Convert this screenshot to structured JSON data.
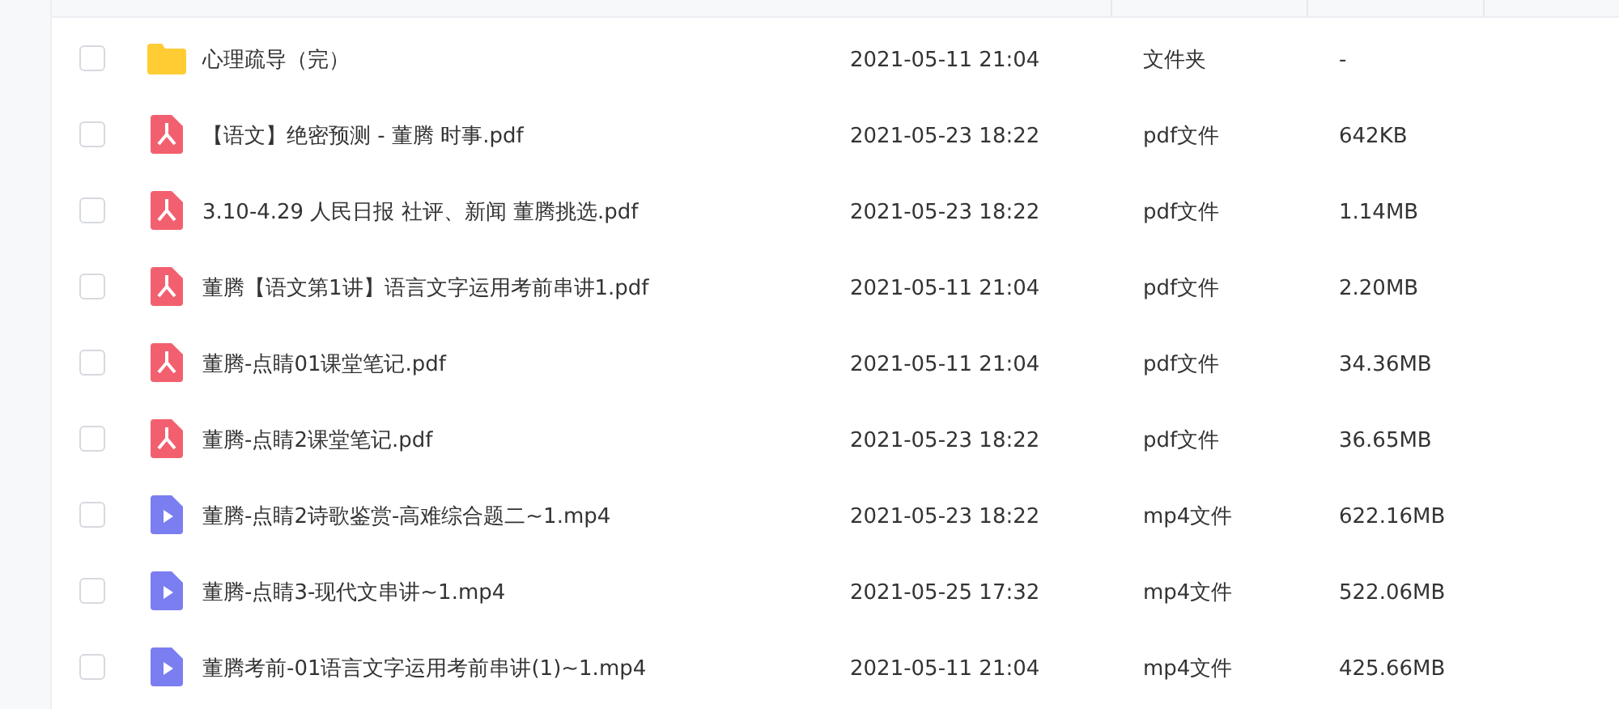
{
  "files": [
    {
      "kind": "folder",
      "checked": false,
      "name": "心理疏导（完）",
      "modified": "2021-05-11 21:04",
      "type": "文件夹",
      "size": "-"
    },
    {
      "kind": "pdf",
      "checked": false,
      "name": "【语文】绝密预测 - 董腾 时事.pdf",
      "modified": "2021-05-23 18:22",
      "type": "pdf文件",
      "size": "642KB"
    },
    {
      "kind": "pdf",
      "checked": false,
      "name": "3.10-4.29 人民日报 社评、新闻 董腾挑选.pdf",
      "modified": "2021-05-23 18:22",
      "type": "pdf文件",
      "size": "1.14MB"
    },
    {
      "kind": "pdf",
      "checked": false,
      "name": "董腾【语文第1讲】语言文字运用考前串讲1.pdf",
      "modified": "2021-05-11 21:04",
      "type": "pdf文件",
      "size": "2.20MB"
    },
    {
      "kind": "pdf",
      "checked": false,
      "name": "董腾-点睛01课堂笔记.pdf",
      "modified": "2021-05-11 21:04",
      "type": "pdf文件",
      "size": "34.36MB"
    },
    {
      "kind": "pdf",
      "checked": false,
      "name": "董腾-点睛2课堂笔记.pdf",
      "modified": "2021-05-23 18:22",
      "type": "pdf文件",
      "size": "36.65MB"
    },
    {
      "kind": "video",
      "checked": false,
      "name": "董腾-点睛2诗歌鉴赏-高难综合题二~1.mp4",
      "modified": "2021-05-23 18:22",
      "type": "mp4文件",
      "size": "622.16MB"
    },
    {
      "kind": "video",
      "checked": false,
      "name": "董腾-点睛3-现代文串讲~1.mp4",
      "modified": "2021-05-25 17:32",
      "type": "mp4文件",
      "size": "522.06MB"
    },
    {
      "kind": "video",
      "checked": false,
      "name": "董腾考前-01语言文字运用考前串讲(1)~1.mp4",
      "modified": "2021-05-11 21:04",
      "type": "mp4文件",
      "size": "425.66MB"
    }
  ]
}
